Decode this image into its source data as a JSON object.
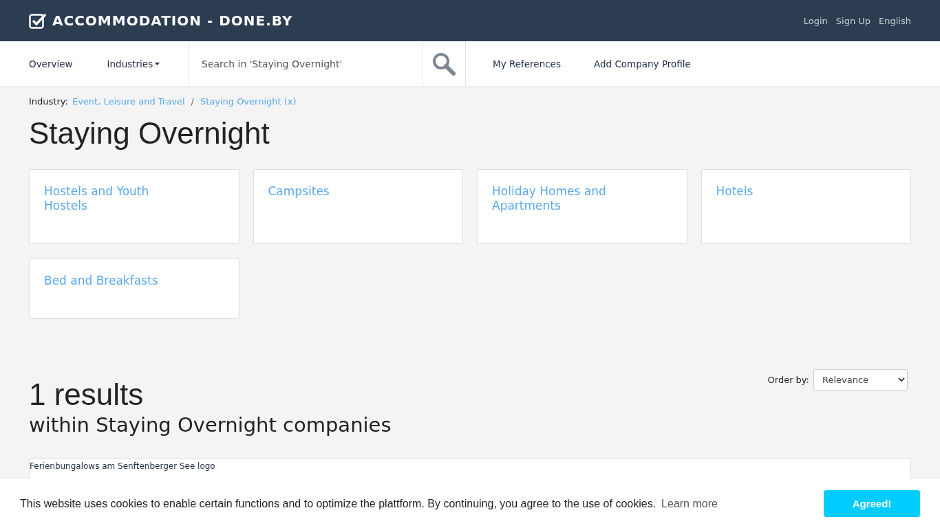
{
  "header": {
    "logo": "ACCOMMODATION - DONE.BY",
    "links": [
      "Login",
      "Sign Up",
      "English"
    ]
  },
  "nav": {
    "items": [
      {
        "label": "Overview",
        "kind": "link"
      },
      {
        "label": "Industries",
        "kind": "dropdown"
      }
    ],
    "search": {
      "placeholder": "Search in 'Staying Overnight'"
    },
    "links": [
      "My References",
      "Add Company Profile"
    ]
  },
  "breadcrumb": {
    "label": "Industry:",
    "items": [
      "Event, Leisure and Travel",
      "Staying Overnight (x)"
    ],
    "separator": "/"
  },
  "title": "Staying Overnight",
  "categories": [
    "Hostels and Youth Hostels",
    "Campsites",
    "Holiday Homes and Apartments",
    "Hotels",
    "Bed and Breakfasts"
  ],
  "results": {
    "count": "1 results",
    "subtitle": "within Staying Overnight companies",
    "order_label": "Order by:",
    "order_value": "Relevance",
    "items": [
      "Ferienbungalows am Senftenberger See logo"
    ]
  },
  "cookie_bar": {
    "message": "This website uses cookies to enable certain functions and to optimize the plattform. By continuing, you agree to the use of cookies.",
    "link": "Learn more",
    "button": "Agreed!"
  }
}
